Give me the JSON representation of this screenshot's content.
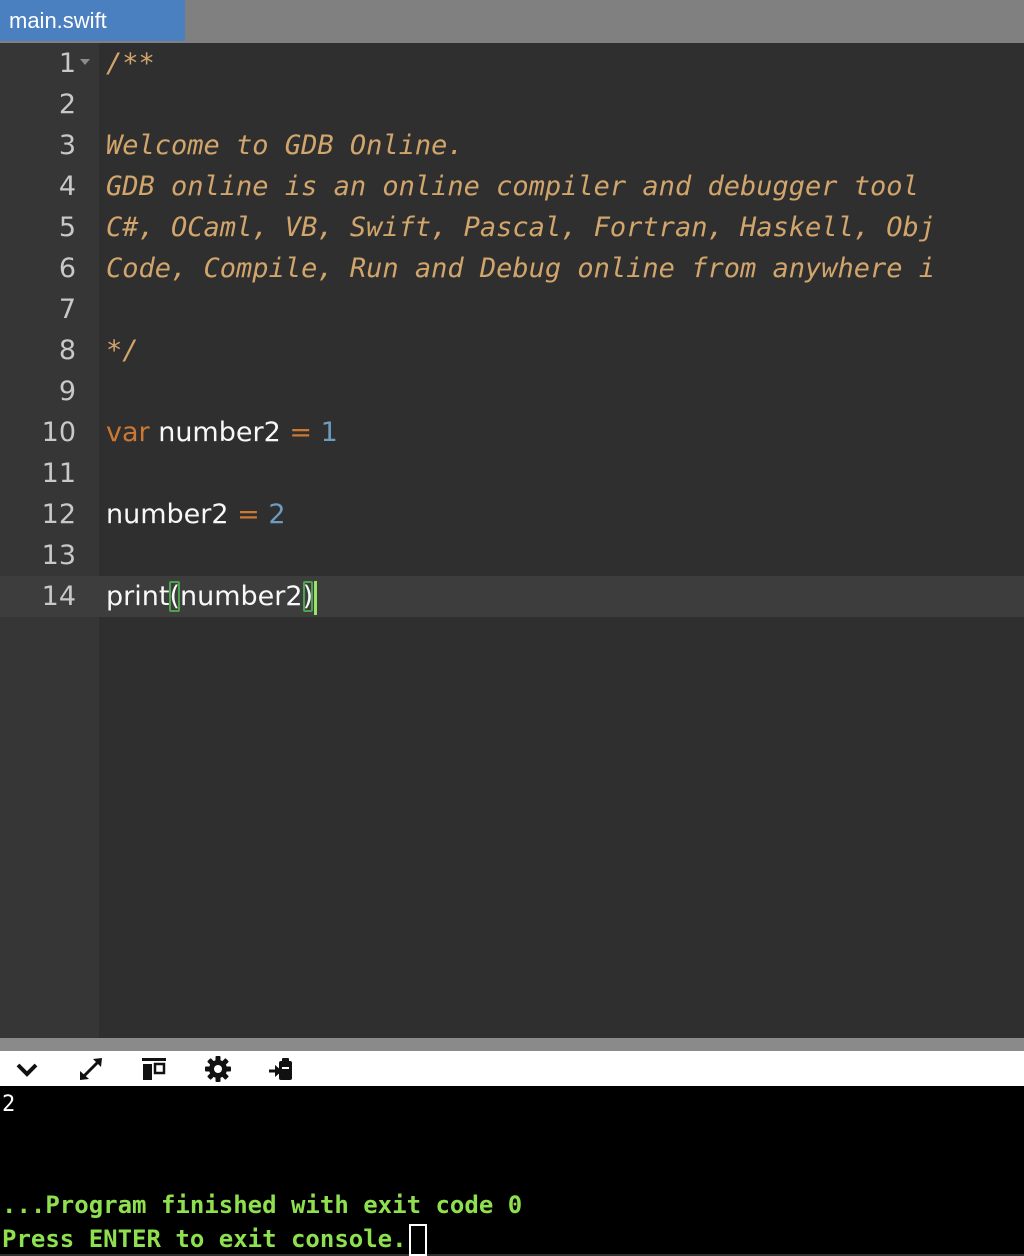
{
  "tab": {
    "filename": "main.swift"
  },
  "editor": {
    "lines": [
      {
        "n": "1"
      },
      {
        "n": "2"
      },
      {
        "n": "3"
      },
      {
        "n": "4"
      },
      {
        "n": "5"
      },
      {
        "n": "6"
      },
      {
        "n": "7"
      },
      {
        "n": "8"
      },
      {
        "n": "9"
      },
      {
        "n": "10"
      },
      {
        "n": "11"
      },
      {
        "n": "12"
      },
      {
        "n": "13"
      },
      {
        "n": "14"
      }
    ],
    "code": {
      "l1": "/**",
      "l3": "Welcome to GDB Online.",
      "l4": "GDB online is an online compiler and debugger tool",
      "l5": "C#, OCaml, VB, Swift, Pascal, Fortran, Haskell, Obj",
      "l6": "Code, Compile, Run and Debug online from anywhere i",
      "l8": "*/",
      "l10": {
        "kw": "var",
        "ident": " number2 ",
        "op": "=",
        "num": "1"
      },
      "l12": {
        "ident": "number2 ",
        "op": "=",
        "num": "2"
      },
      "l14": {
        "fn": "print",
        "open": "(",
        "arg": "number2",
        "close": ")"
      }
    }
  },
  "toolbar": {
    "icons": [
      "chevron-down-icon",
      "expand-icon",
      "layout-icon",
      "gear-icon",
      "stdin-icon"
    ]
  },
  "console": {
    "output": "2",
    "finished": "...Program finished with exit code 0",
    "press_enter": "Press ENTER to exit console."
  },
  "colors": {
    "tab_active": "#4a7fc0",
    "comment": "#d1a56b",
    "keyword": "#cc7833",
    "number": "#6d9cbe",
    "console_green": "#8fe04e"
  }
}
